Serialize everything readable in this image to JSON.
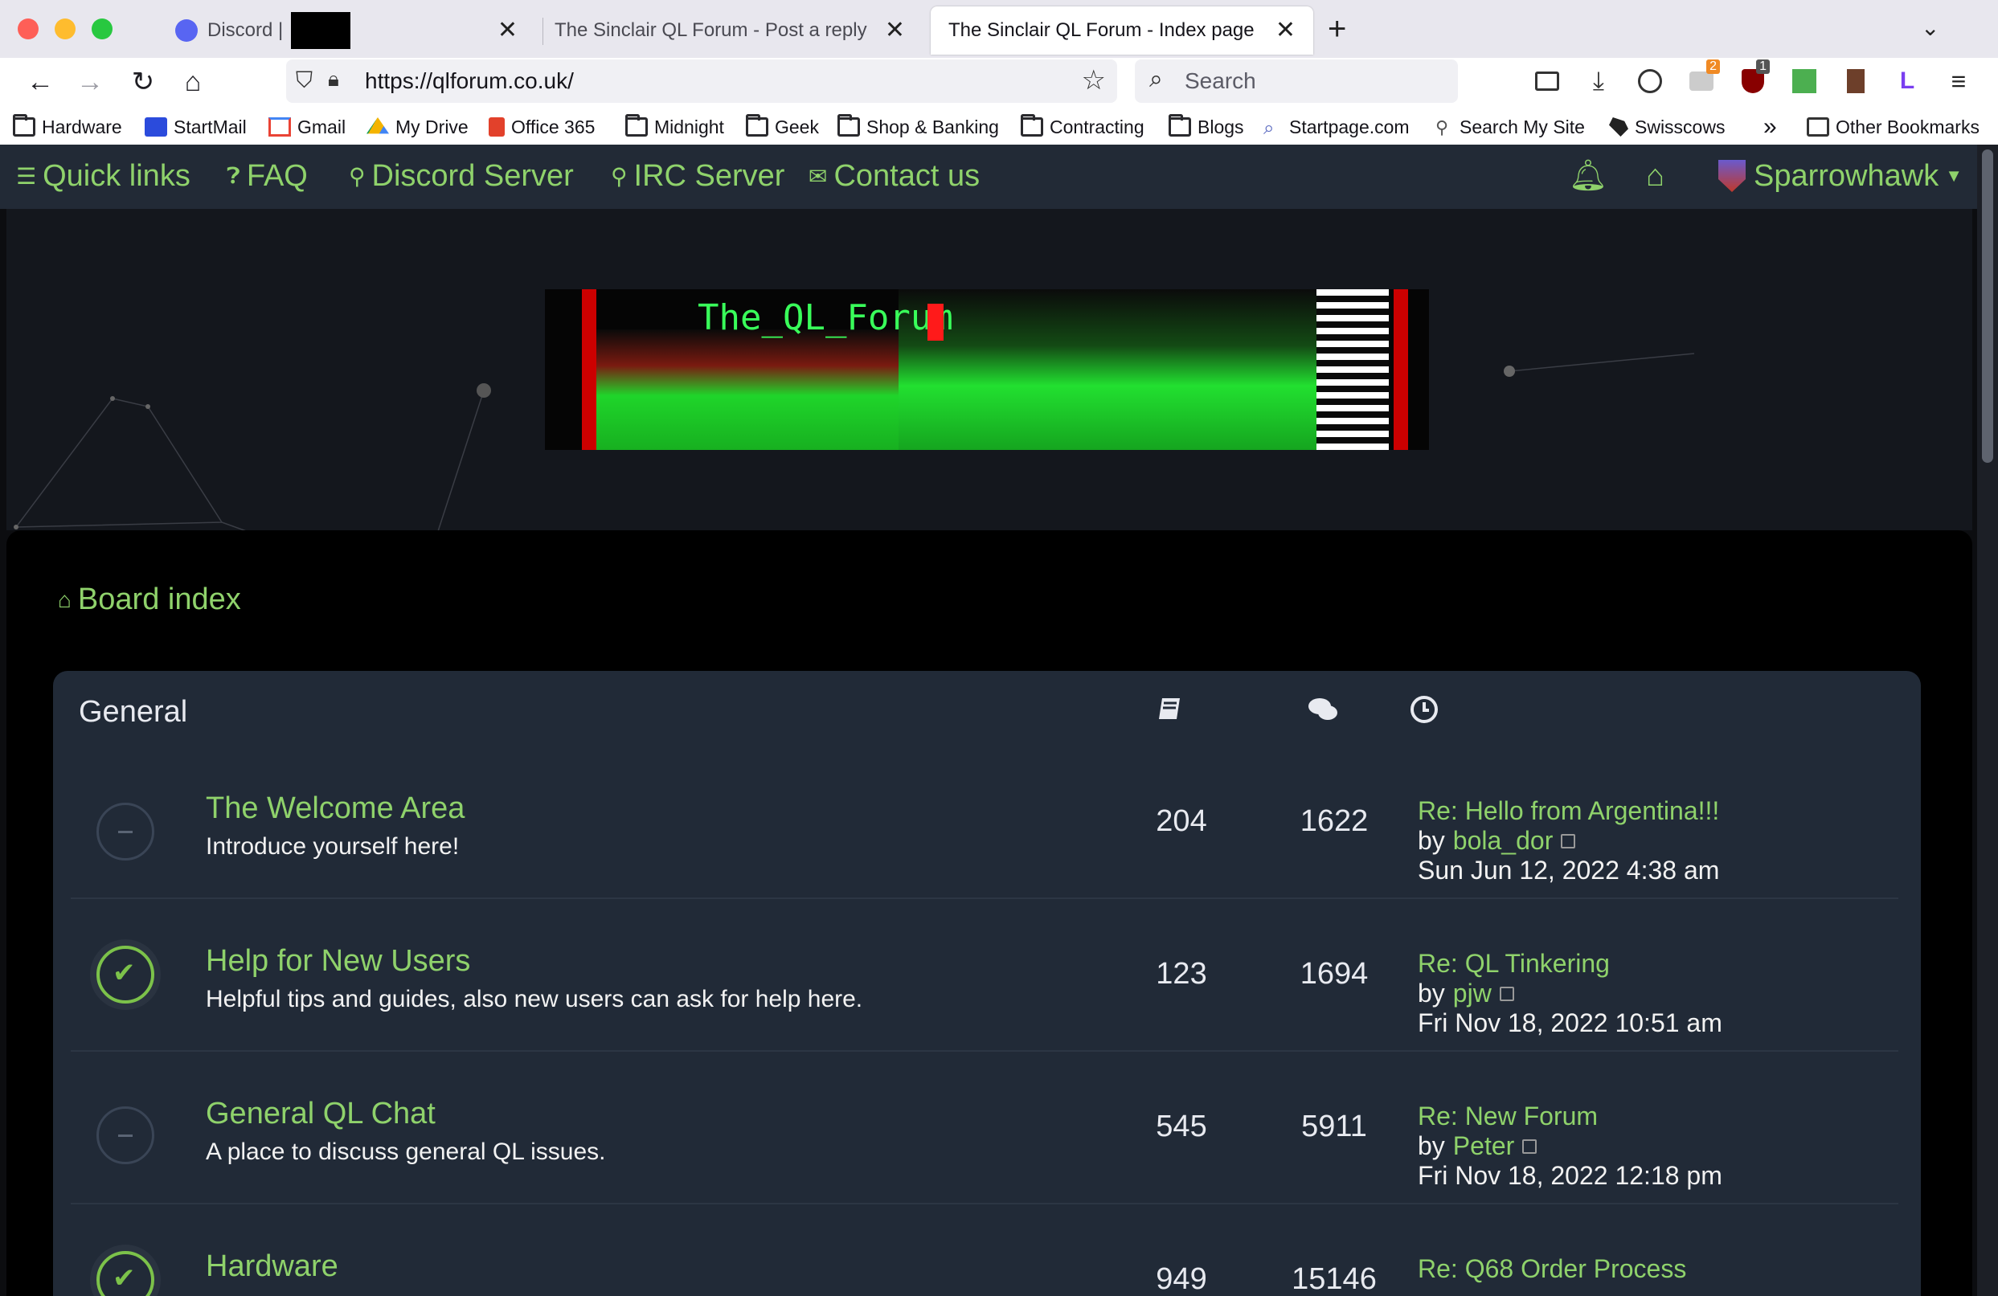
{
  "tabs": [
    {
      "label": "Discord |",
      "close": "✕"
    },
    {
      "label": "The Sinclair QL Forum - Post a reply",
      "close": "✕"
    },
    {
      "label": "The Sinclair QL Forum - Index page",
      "close": "✕"
    }
  ],
  "new_tab": "+",
  "url": "https://qlforum.co.uk/",
  "search_placeholder": "Search",
  "extensions": [
    {
      "badge": "2"
    },
    {
      "badge": "1"
    }
  ],
  "bookmarks": [
    {
      "label": "Hardware",
      "icon": "folder"
    },
    {
      "label": "StartMail",
      "icon": "startmail"
    },
    {
      "label": "Gmail",
      "icon": "gmail"
    },
    {
      "label": "My Drive",
      "icon": "drive"
    },
    {
      "label": "Office 365",
      "icon": "office"
    },
    {
      "label": "Midnight",
      "icon": "folder"
    },
    {
      "label": "Geek",
      "icon": "folder"
    },
    {
      "label": "Shop & Banking",
      "icon": "folder"
    },
    {
      "label": "Contracting",
      "icon": "folder"
    },
    {
      "label": "Blogs",
      "icon": "folder"
    },
    {
      "label": "Startpage.com",
      "icon": "startpage"
    },
    {
      "label": "Search My Site",
      "icon": "pin"
    },
    {
      "label": "Swisscows",
      "icon": "swisscows"
    }
  ],
  "other_bookmarks": "Other Bookmarks",
  "nav": {
    "quick_links": "Quick links",
    "faq": "FAQ",
    "discord": "Discord Server",
    "irc": "IRC Server",
    "contact": "Contact us",
    "user": "Sparrowhawk"
  },
  "banner_text": "The_QL_Forum",
  "breadcrumb": "Board index",
  "category": "General",
  "forums": [
    {
      "title": "The Welcome Area",
      "desc": "Introduce yourself here!",
      "topics": "204",
      "posts": "1622",
      "last_title": "Re: Hello from Argentina!!!",
      "by": "by",
      "user": "bola_dor",
      "date": "Sun Jun 12, 2022 4:38 am",
      "unread": false
    },
    {
      "title": "Help for New Users",
      "desc": "Helpful tips and guides, also new users can ask for help here.",
      "topics": "123",
      "posts": "1694",
      "last_title": "Re: QL Tinkering",
      "by": "by",
      "user": "pjw",
      "date": "Fri Nov 18, 2022 10:51 am",
      "unread": true
    },
    {
      "title": "General QL Chat",
      "desc": "A place to discuss general QL issues.",
      "topics": "545",
      "posts": "5911",
      "last_title": "Re: New Forum",
      "by": "by",
      "user": "Peter",
      "date": "Fri Nov 18, 2022 12:18 pm",
      "unread": false
    },
    {
      "title": "Hardware",
      "desc": "",
      "topics": "949",
      "posts": "15146",
      "last_title": "Re: Q68 Order Process",
      "by": "",
      "user": "",
      "date": "",
      "unread": true
    }
  ],
  "colors": {
    "accent": "#8fd26b",
    "panel": "#212a37",
    "navbar": "#222a36"
  }
}
